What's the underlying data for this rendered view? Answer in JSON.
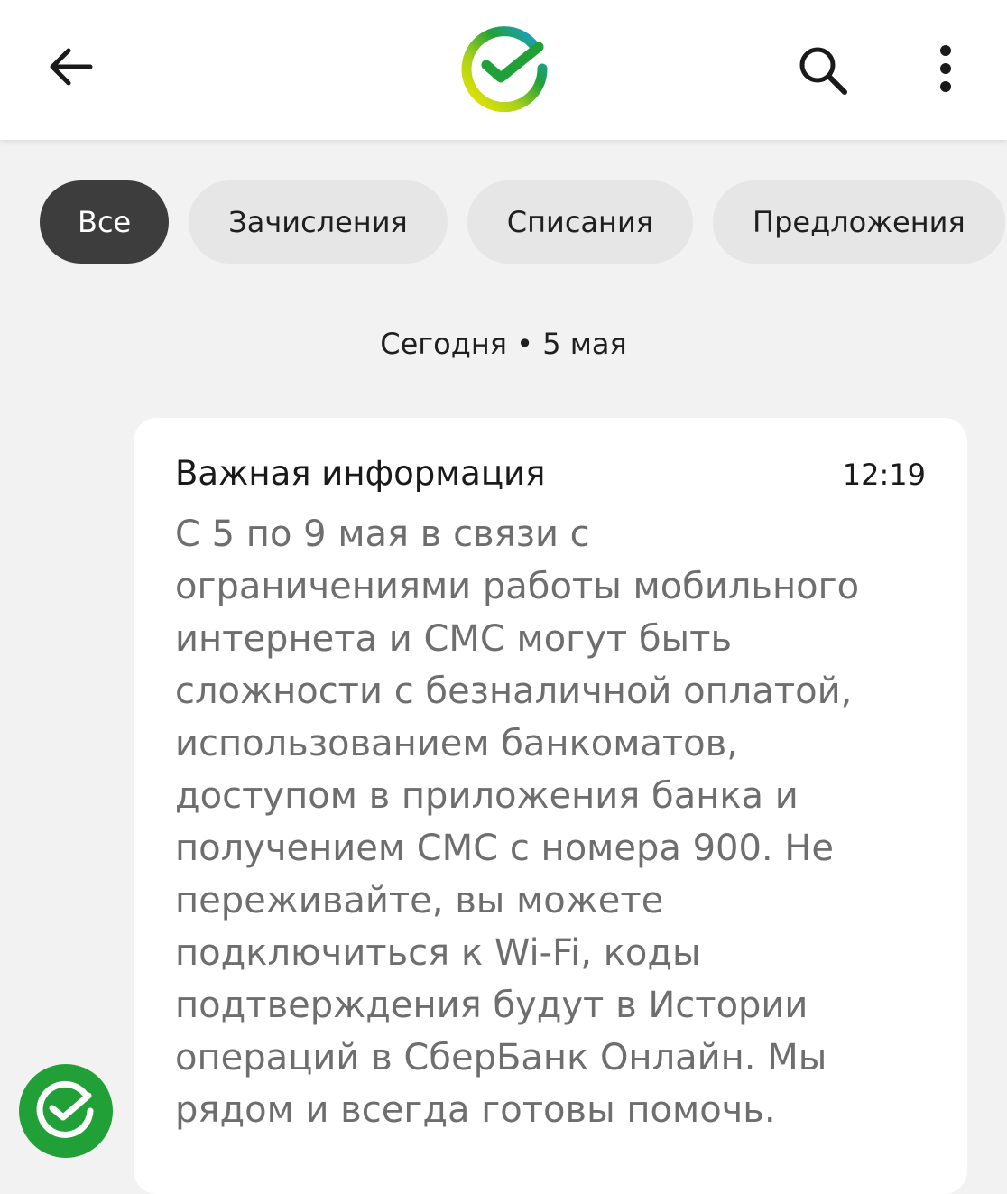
{
  "filters": [
    {
      "label": "Все",
      "active": true
    },
    {
      "label": "Зачисления",
      "active": false
    },
    {
      "label": "Списания",
      "active": false
    },
    {
      "label": "Предложения",
      "active": false
    }
  ],
  "feed": {
    "date_separator": "Сегодня • 5 мая"
  },
  "message": {
    "title": "Важная информация",
    "time": "12:19",
    "lines": [
      "С 5 по 9 мая в связи с",
      "ограничениями работы мобильного",
      "интернета и СМС могут быть",
      "сложности с безналичной оплатой,",
      "использованием банкоматов,",
      "доступом в приложения банка и",
      "получением СМС с номера 900. Не",
      "переживайте, вы можете",
      "подключиться к Wi-Fi, коды",
      "подтверждения будут в Истории",
      "операций в СберБанк Онлайн. Мы",
      "рядом и всегда готовы помочь."
    ]
  },
  "icons": {
    "back": "back-arrow-icon",
    "logo": "sber-logo-icon",
    "search": "search-icon",
    "more": "more-vertical-icon",
    "avatar": "sber-avatar-icon"
  },
  "colors": {
    "brand_green": "#21a038",
    "chip_active_bg": "#3d3d3d",
    "chip_bg": "#e6e6e6",
    "background": "#f2f2f2",
    "body_text": "#6e6e6e"
  }
}
